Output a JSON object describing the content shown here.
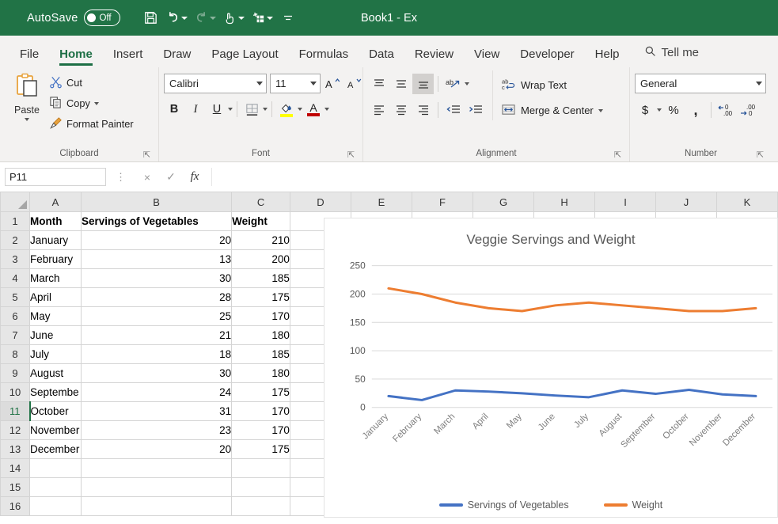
{
  "titlebar": {
    "autosave_label": "AutoSave",
    "autosave_state": "Off",
    "document_title": "Book1",
    "title_separator": "-",
    "app_name": "Ex",
    "quick_access": [
      {
        "name": "save-icon",
        "label": "Save"
      },
      {
        "name": "undo-icon",
        "label": "Undo"
      },
      {
        "name": "redo-icon",
        "label": "Redo"
      },
      {
        "name": "touch-mode-icon",
        "label": "Touch/Mouse Mode"
      },
      {
        "name": "new-sheet-icon",
        "label": "Customize"
      },
      {
        "name": "more-commands-icon",
        "label": "More"
      }
    ]
  },
  "tabs": [
    {
      "label": "File",
      "active": false
    },
    {
      "label": "Home",
      "active": true
    },
    {
      "label": "Insert",
      "active": false
    },
    {
      "label": "Draw",
      "active": false
    },
    {
      "label": "Page Layout",
      "active": false
    },
    {
      "label": "Formulas",
      "active": false
    },
    {
      "label": "Data",
      "active": false
    },
    {
      "label": "Review",
      "active": false
    },
    {
      "label": "View",
      "active": false
    },
    {
      "label": "Developer",
      "active": false
    },
    {
      "label": "Help",
      "active": false
    }
  ],
  "tellme": {
    "label": "Tell me",
    "icon": "search-icon"
  },
  "ribbon": {
    "clipboard": {
      "title": "Clipboard",
      "paste": "Paste",
      "cut": "Cut",
      "copy": "Copy",
      "format_painter": "Format Painter"
    },
    "font": {
      "title": "Font",
      "font_name": "Calibri",
      "font_size": "11",
      "bold": "B",
      "italic": "I",
      "underline": "U",
      "increase_size": "A",
      "decrease_size": "A",
      "fill_color": "#FFFF00",
      "font_color": "#C00000"
    },
    "alignment": {
      "title": "Alignment",
      "wrap_text": "Wrap Text",
      "merge_center": "Merge & Center"
    },
    "number": {
      "title": "Number",
      "format": "General",
      "currency": "$",
      "percent": "%",
      "comma": ",",
      "increase_decimal": ".00",
      "decrease_decimal": ".0"
    }
  },
  "formula_bar": {
    "name_box": "P11",
    "cancel": "×",
    "enter": "✓",
    "insert_function": "fx",
    "formula_value": ""
  },
  "grid": {
    "columns": [
      "A",
      "B",
      "C",
      "D",
      "E",
      "F",
      "G",
      "H",
      "I",
      "J",
      "K"
    ],
    "rows": [
      "1",
      "2",
      "3",
      "4",
      "5",
      "6",
      "7",
      "8",
      "9",
      "10",
      "11",
      "12",
      "13",
      "14",
      "15",
      "16"
    ],
    "selected_row": "11",
    "headers": {
      "a": "Month",
      "b": "Servings of Vegetables",
      "c": "Weight"
    },
    "data": [
      {
        "month": "January",
        "servings": "20",
        "weight": "210"
      },
      {
        "month": "February",
        "servings": "13",
        "weight": "200"
      },
      {
        "month": "March",
        "servings": "30",
        "weight": "185"
      },
      {
        "month": "April",
        "servings": "28",
        "weight": "175"
      },
      {
        "month": "May",
        "servings": "25",
        "weight": "170"
      },
      {
        "month": "June",
        "servings": "21",
        "weight": "180"
      },
      {
        "month": "July",
        "servings": "18",
        "weight": "185"
      },
      {
        "month": "August",
        "servings": "30",
        "weight": "180"
      },
      {
        "month": "Septembe",
        "servings": "24",
        "weight": "175"
      },
      {
        "month": "October",
        "servings": "31",
        "weight": "170"
      },
      {
        "month": "November",
        "servings": "23",
        "weight": "170"
      },
      {
        "month": "December",
        "servings": "20",
        "weight": "175"
      }
    ]
  },
  "chart_data": {
    "type": "line",
    "title": "Veggie Servings and Weight",
    "categories": [
      "January",
      "February",
      "March",
      "April",
      "May",
      "June",
      "July",
      "August",
      "September",
      "October",
      "November",
      "December"
    ],
    "series": [
      {
        "name": "Servings of Vegetables",
        "color": "#4472C4",
        "values": [
          20,
          13,
          30,
          28,
          25,
          21,
          18,
          30,
          24,
          31,
          23,
          20
        ]
      },
      {
        "name": "Weight",
        "color": "#ED7D31",
        "values": [
          210,
          200,
          185,
          175,
          170,
          180,
          185,
          180,
          175,
          170,
          170,
          175
        ]
      }
    ],
    "xlabel": "",
    "ylabel": "",
    "ylim": [
      0,
      250
    ],
    "yticks": [
      0,
      50,
      100,
      150,
      200,
      250
    ],
    "grid": true,
    "legend_position": "bottom",
    "xtick_rotation": 45
  }
}
